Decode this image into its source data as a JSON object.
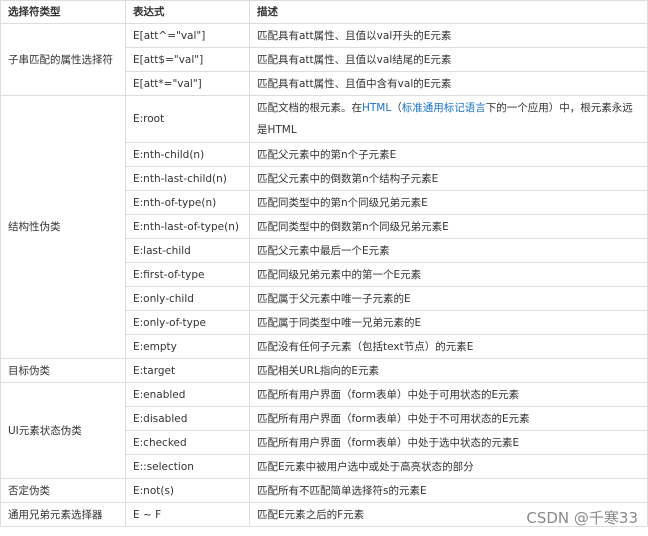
{
  "table": {
    "headers": [
      "选择符类型",
      "表达式",
      "描述"
    ],
    "groups": [
      {
        "type": "子串匹配的属性选择符",
        "rows": [
          {
            "expr": "E[att^=\"val\"]",
            "desc": "匹配具有att属性、且值以val开头的E元素"
          },
          {
            "expr": "E[att$=\"val\"]",
            "desc": "匹配具有att属性、且值以val结尾的E元素"
          },
          {
            "expr": "E[att*=\"val\"]",
            "desc": "匹配具有att属性、且值中含有val的E元素"
          }
        ]
      },
      {
        "type": "结构性伪类",
        "rows": [
          {
            "expr": "E:root",
            "desc": "",
            "tall": true,
            "desc_parts": [
              "匹配文档的根元素。在",
              "HTML",
              "（",
              "标准通用标记语言",
              "下的一个应用）中，根元素永远是HTML"
            ]
          },
          {
            "expr": "E:nth-child(n)",
            "desc": "匹配父元素中的第n个子元素E"
          },
          {
            "expr": "E:nth-last-child(n)",
            "desc": "匹配父元素中的倒数第n个结构子元素E"
          },
          {
            "expr": "E:nth-of-type(n)",
            "desc": "匹配同类型中的第n个同级兄弟元素E"
          },
          {
            "expr": "E:nth-last-of-type(n)",
            "desc": "匹配同类型中的倒数第n个同级兄弟元素E"
          },
          {
            "expr": "E:last-child",
            "desc": "匹配父元素中最后一个E元素"
          },
          {
            "expr": "E:first-of-type",
            "desc": "匹配同级兄弟元素中的第一个E元素"
          },
          {
            "expr": "E:only-child",
            "desc": "匹配属于父元素中唯一子元素的E"
          },
          {
            "expr": "E:only-of-type",
            "desc": "匹配属于同类型中唯一兄弟元素的E"
          },
          {
            "expr": "E:empty",
            "desc": "匹配没有任何子元素（包括text节点）的元素E"
          }
        ]
      },
      {
        "type": "目标伪类",
        "rows": [
          {
            "expr": "E:target",
            "desc": "匹配相关URL指向的E元素"
          }
        ]
      },
      {
        "type": "UI元素状态伪类",
        "rows": [
          {
            "expr": "E:enabled",
            "desc": "匹配所有用户界面（form表单）中处于可用状态的E元素"
          },
          {
            "expr": "E:disabled",
            "desc": "匹配所有用户界面（form表单）中处于不可用状态的E元素"
          },
          {
            "expr": "E:checked",
            "desc": "匹配所有用户界面（form表单）中处于选中状态的元素E"
          },
          {
            "expr": "E::selection",
            "desc": "匹配E元素中被用户选中或处于高亮状态的部分"
          }
        ]
      },
      {
        "type": "否定伪类",
        "rows": [
          {
            "expr": "E:not(s)",
            "desc": "匹配所有不匹配简单选择符s的元素E"
          }
        ]
      },
      {
        "type": "通用兄弟元素选择器",
        "rows": [
          {
            "expr": "E ~ F",
            "desc": "匹配E元素之后的F元素"
          }
        ]
      }
    ]
  },
  "watermark": "CSDN @千寒33",
  "colors": {
    "link": "#1a72c7",
    "border": "#dddddd",
    "text": "#333333"
  }
}
